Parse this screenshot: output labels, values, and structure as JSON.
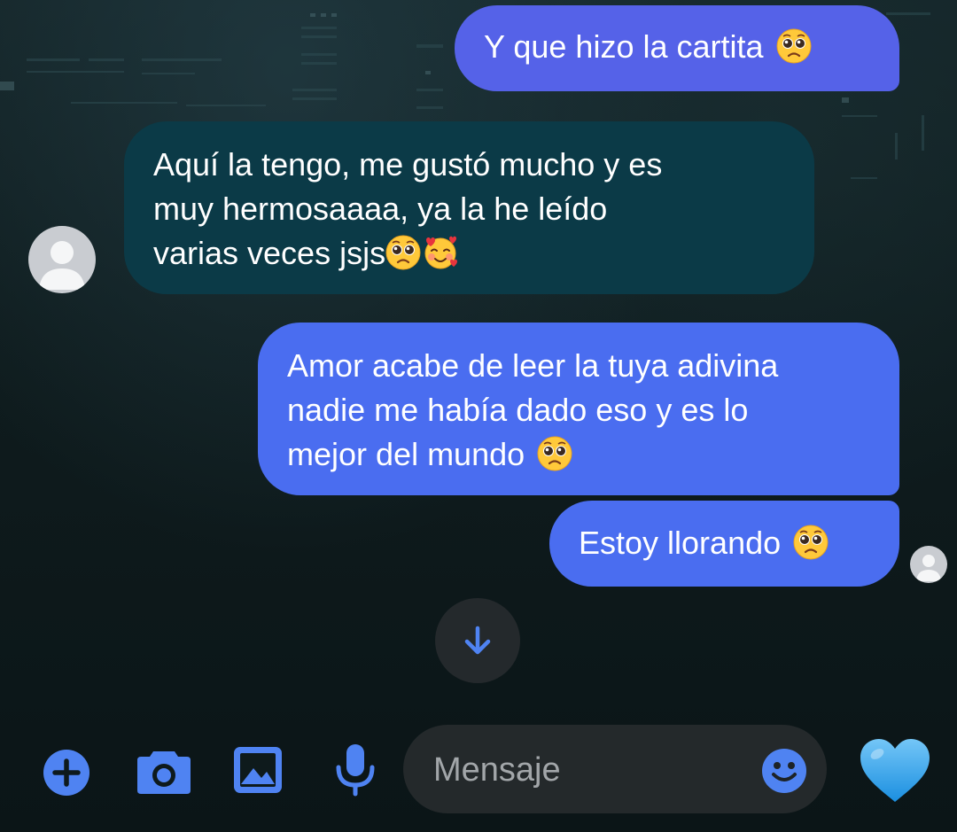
{
  "messages": [
    {
      "id": "m1",
      "direction": "outgoing",
      "text": "Y que hizo la cartita",
      "emojis": [
        "pleading-face"
      ]
    },
    {
      "id": "m2",
      "direction": "incoming",
      "lines": [
        "Aquí la tengo, me gustó mucho y es",
        "muy hermosaaaa, ya la he leído",
        "varias veces jsjs"
      ],
      "emojis": [
        "pleading-face",
        "smiling-face-with-hearts"
      ]
    },
    {
      "id": "m3",
      "direction": "outgoing",
      "lines": [
        "Amor acabe de leer la tuya adivina",
        "nadie me había dado eso y es lo",
        "mejor del mundo"
      ],
      "emojis": [
        "pleading-face"
      ]
    },
    {
      "id": "m4",
      "direction": "outgoing",
      "text": "Estoy llorando",
      "emojis": [
        "pleading-face"
      ]
    }
  ],
  "composer": {
    "placeholder": "Mensaje"
  },
  "toolbar": {
    "icons": [
      "plus-icon",
      "camera-icon",
      "image-icon",
      "microphone-icon",
      "emoji-icon",
      "blue-heart-icon"
    ]
  },
  "colors": {
    "outgoing_bubble": "#4a6df0",
    "incoming_bubble": "#0b3a47",
    "accent": "#4f83f2",
    "background": "#0e1a1c"
  }
}
